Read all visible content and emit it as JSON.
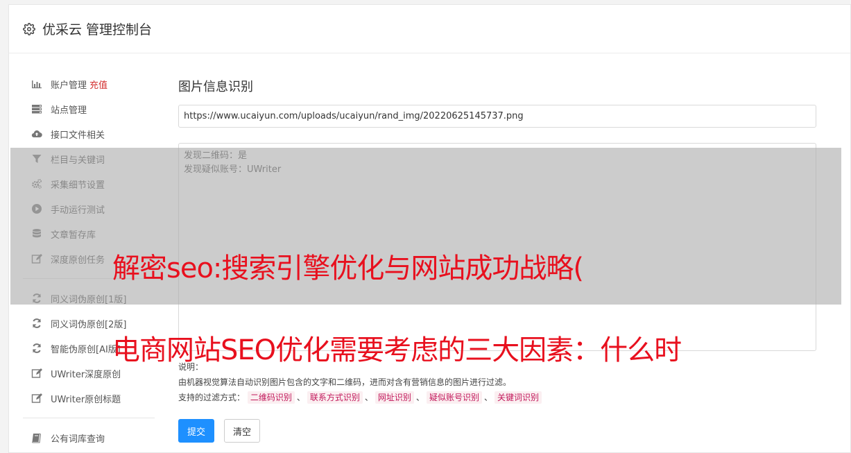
{
  "header": {
    "title": "优采云 管理控制台",
    "icon": "gear-icon"
  },
  "sidebar": {
    "group1": [
      {
        "label": "账户管理",
        "badge": "充值",
        "icon": "bar-chart-icon"
      },
      {
        "label": "站点管理",
        "icon": "server-icon"
      },
      {
        "label": "接口文件相关",
        "icon": "cloud-upload-icon"
      },
      {
        "label": "栏目与关键词",
        "icon": "filter-icon"
      },
      {
        "label": "采集细节设置",
        "icon": "cogs-icon"
      },
      {
        "label": "手动运行测试",
        "icon": "play-circle-icon"
      },
      {
        "label": "文章暂存库",
        "icon": "database-icon"
      },
      {
        "label": "深度原创任务",
        "icon": "edit-icon"
      }
    ],
    "group2": [
      {
        "label": "同义词伪原创[1版]",
        "icon": "refresh-icon"
      },
      {
        "label": "同义词伪原创[2版]",
        "icon": "refresh-icon"
      },
      {
        "label": "智能伪原创[AI版]",
        "icon": "refresh-icon"
      },
      {
        "label": "UWriter深度原创",
        "icon": "edit-icon"
      },
      {
        "label": "UWriter原创标题",
        "icon": "edit-icon"
      }
    ],
    "group3": [
      {
        "label": "公有词库查询",
        "icon": "book-icon"
      }
    ]
  },
  "main": {
    "title": "图片信息识别",
    "url_value": "https://www.ucaiyun.com/uploads/ucaiyun/rand_img/20220625145737.png",
    "result_lines": [
      "发现二维码：是",
      "发现疑似账号：UWriter"
    ],
    "notes": {
      "label": "说明：",
      "description": "由机器视觉算法自动识别图片包含的文字和二维码，进而对含有营销信息的图片进行过滤。",
      "filters_label": "支持的过滤方式：",
      "filters": [
        "二维码识别",
        "联系方式识别",
        "网址识别",
        "疑似账号识别",
        "关键词识别"
      ],
      "separator": "、"
    },
    "submit_label": "提交",
    "clear_label": "清空"
  },
  "overlay": {
    "line1": "解密seo:搜索引擎优化与网站成功战略(",
    "line2": "电商网站SEO优化需要考虑的三大因素：什么时"
  },
  "colors": {
    "accent": "#1e90ff",
    "badge": "#d32f2f",
    "overlay_text": "#e8101e",
    "tag_text": "#c2185b",
    "tag_bg": "#fbeff1"
  }
}
